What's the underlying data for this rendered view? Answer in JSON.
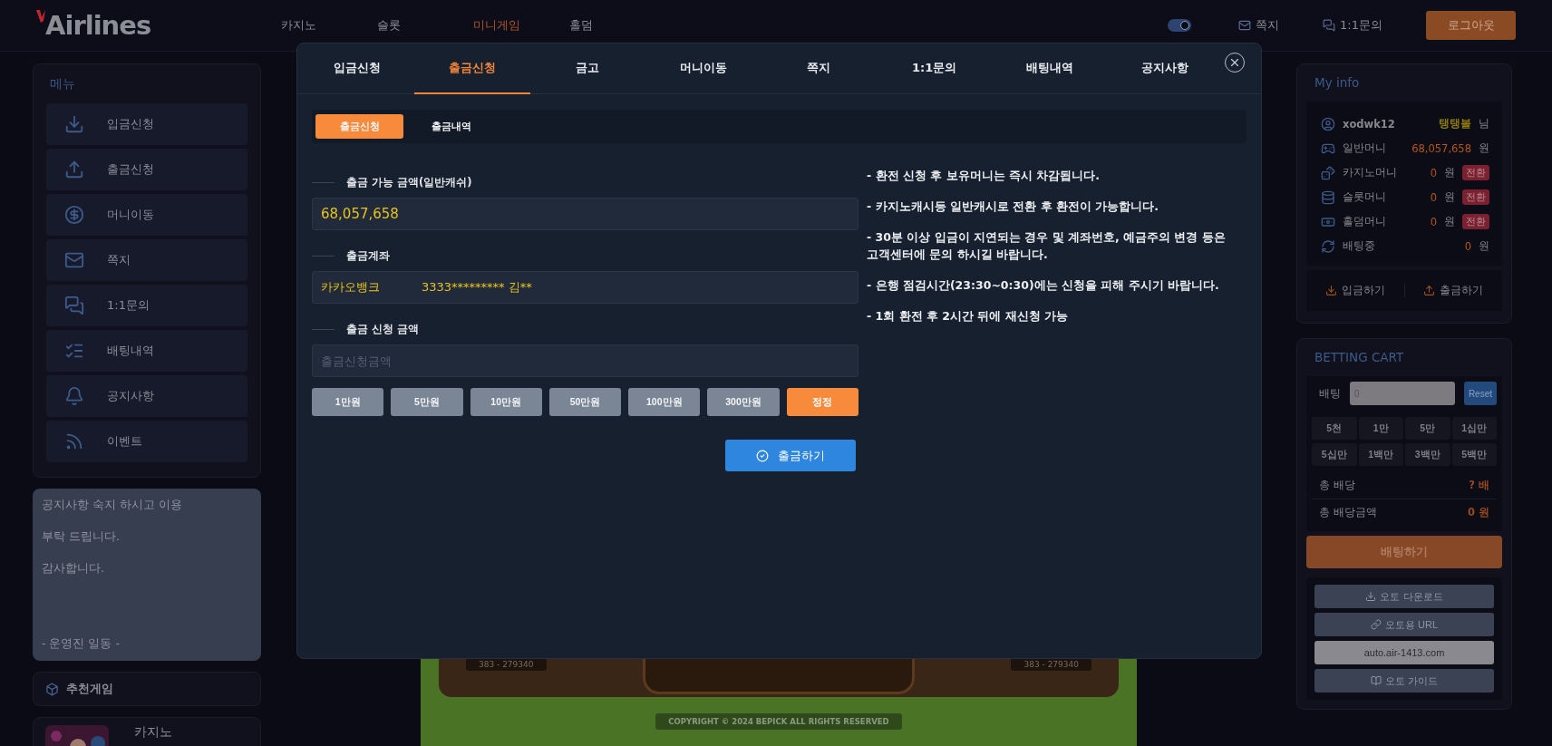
{
  "header": {
    "logo": "Airlines",
    "nav": [
      {
        "label": "카지노",
        "selected": false
      },
      {
        "label": "슬롯",
        "selected": false
      },
      {
        "label": "미니게임",
        "selected": true
      },
      {
        "label": "홀덤",
        "selected": false
      }
    ],
    "dark_mode": {
      "on": true
    },
    "links": [
      "쪽지",
      "1:1문의"
    ],
    "logout": "로그아웃"
  },
  "sidebar": {
    "title": "메뉴",
    "items": [
      "입금신청",
      "출금신청",
      "머니이동",
      "쪽지",
      "1:1문의",
      "배팅내역",
      "공지사항",
      "이벤트"
    ],
    "notice": [
      "공지사항 숙지 하시고 이용",
      "부탁 드립니다.",
      "감사합니다."
    ],
    "signature": "- 운영진 일동 -",
    "recommended_title": "추천게임",
    "game": {
      "title": "카지노",
      "kind": "picture"
    }
  },
  "board": {
    "plates": [
      "383 - 279340",
      "383 - 279340"
    ],
    "copyright": "COPYRIGHT © 2024 BEPICK ALL RIGHTS RESERVED"
  },
  "modal": {
    "tabs": [
      {
        "label": "입금신청",
        "selected": false
      },
      {
        "label": "출금신청",
        "selected": true
      },
      {
        "label": "금고",
        "selected": false
      },
      {
        "label": "머니이동",
        "selected": false
      },
      {
        "label": "쪽지",
        "selected": false
      },
      {
        "label": "1:1문의",
        "selected": false
      },
      {
        "label": "배팅내역",
        "selected": false
      },
      {
        "label": "공지사항",
        "selected": false
      }
    ],
    "subtabs": [
      {
        "label": "출금신청",
        "selected": true
      },
      {
        "label": "출금내역",
        "selected": false
      }
    ],
    "fields": [
      {
        "label": "출금 가능 금액(일반캐쉬)",
        "kind": "value",
        "value": "68,057,658"
      },
      {
        "label": "출금계좌",
        "kind": "account",
        "bank": "카카오뱅크",
        "account": "3333********* 김**"
      },
      {
        "label": "출금 신청 금액",
        "kind": "input",
        "placeholder": "출금신청금액"
      }
    ],
    "amounts": [
      {
        "label": "1만원",
        "kind": "amount"
      },
      {
        "label": "5만원",
        "kind": "amount"
      },
      {
        "label": "10만원",
        "kind": "amount"
      },
      {
        "label": "50만원",
        "kind": "amount"
      },
      {
        "label": "100만원",
        "kind": "amount"
      },
      {
        "label": "300만원",
        "kind": "amount"
      },
      {
        "label": "정정",
        "kind": "reset"
      }
    ],
    "submit": "출금하기",
    "notes": [
      "- 환전 신청 후 보유머니는 즉시 차감됩니다.",
      "- 카지노캐시등 일반캐시로 전환 후 환전이 가능합니다.",
      "- 30분 이상 입금이 지연되는 경우 및 계좌번호, 예금주의 변경 등은 고객센터에 문의 하시길 바랍니다.",
      "- 은행 점검시간(23:30~0:30)에는 신청을 피해 주시기 바랍니다.",
      "- 1회 환전 후 2시간 뒤에 재신청 가능"
    ]
  },
  "my_info": {
    "title": "My info",
    "user": {
      "name": "xodwk12",
      "grade": "탱탱볼",
      "suffix": "님"
    },
    "balances": [
      {
        "label": "일반머니",
        "amount": "68,057,658",
        "unit": "원"
      },
      {
        "label": "카지노머니",
        "amount": "0",
        "unit": "원",
        "convert": "전환"
      },
      {
        "label": "슬롯머니",
        "amount": "0",
        "unit": "원",
        "convert": "전환"
      },
      {
        "label": "홀덤머니",
        "amount": "0",
        "unit": "원",
        "convert": "전환"
      },
      {
        "label": "배팅중",
        "amount": "0",
        "unit": "원"
      }
    ],
    "actions": [
      "입금하기",
      "출금하기"
    ]
  },
  "betting_cart": {
    "title": "BETTING CART",
    "bet_label": "배팅",
    "bet_value": "0",
    "reset": "Reset",
    "chips": [
      "5천",
      "1만",
      "5만",
      "1십만",
      "5십만",
      "1백만",
      "3백만",
      "5백만"
    ],
    "totals": [
      {
        "label": "총 배당",
        "value": "? 배"
      },
      {
        "label": "총 배당금액",
        "value": "0 원"
      }
    ],
    "bet_button": "배팅하기",
    "auto": [
      {
        "label": "오토 다운로드",
        "kind": "button"
      },
      {
        "label": "오토용 URL",
        "kind": "button"
      },
      {
        "label": "auto.air-1413.com",
        "kind": "url"
      },
      {
        "label": "오토 가이드",
        "kind": "button"
      }
    ]
  }
}
